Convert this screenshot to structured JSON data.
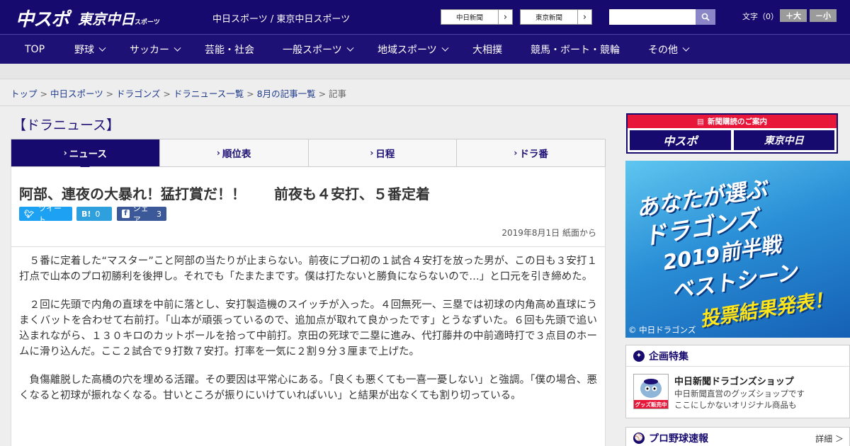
{
  "header": {
    "logo_chuspo": "中スポ",
    "logo_tokyo": "東京中日",
    "logo_tokyo_sub": "スポーツ",
    "site_names": "中日スポーツ / 東京中日スポーツ",
    "link_chunichi": "中日新聞",
    "link_tokyo": "東京新聞",
    "font_label": "文字（0）",
    "font_larger": "＋大",
    "font_smaller": "－小"
  },
  "nav": [
    {
      "label": "TOP"
    },
    {
      "label": "野球"
    },
    {
      "label": "サッカー"
    },
    {
      "label": "芸能・社会"
    },
    {
      "label": "一般スポーツ"
    },
    {
      "label": "地域スポーツ"
    },
    {
      "label": "大相撲"
    },
    {
      "label": "競馬・ボート・競輪"
    },
    {
      "label": "その他"
    }
  ],
  "breadcrumb": [
    "トップ",
    "中日スポーツ",
    "ドラゴンズ",
    "ドラニュース一覧",
    "8月の記事一覧",
    "記事"
  ],
  "section_title": "【ドラニュース】",
  "tabs": [
    "ニュース",
    "順位表",
    "日程",
    "ドラ番"
  ],
  "article": {
    "headline": "阿部、連夜の大暴れ！猛打賞だ！！　　前夜も４安打、５番定着",
    "share": {
      "tweet": "ツイート",
      "hatena_icon": "B!",
      "hatena_count": "0",
      "facebook": "シェア",
      "facebook_count": "3"
    },
    "dateline": "2019年8月1日 紙面から",
    "paragraphs": [
      "５番に定着した“マスター”こと阿部の当たりが止まらない。前夜にプロ初の１試合４安打を放った男が、この日も３安打１打点で山本のプロ初勝利を後押し。それでも「たまたまです。僕は打たないと勝負にならないので…」と口元を引き締めた。",
      "２回に先頭で内角の直球を中前に落とし、安打製造機のスイッチが入った。４回無死一、三塁では初球の内角高め直球にうまくバットを合わせて右前打。「山本が頑張っているので、追加点が取れて良かったです」とうなずいた。６回も先頭で追い込まれながら、１３０キロのカットボールを拾って中前打。京田の死球で二塁に進み、代打藤井の中前適時打で３点目のホームに滑り込んだ。ここ２試合で９打数７安打。打率を一気に２割９分３厘まで上げた。",
      "負傷離脱した高橋の穴を埋める活躍。その要因は平常心にある。「良くも悪くても一喜一憂しない」と強調。「僕の場合、悪くなると初球が振れなくなる。甘いところが振りにいけていればいい」と結果が出なくても割り切っている。"
    ]
  },
  "sidebar": {
    "subscribe_title": "新聞購読のご案内",
    "subscribe_logo1": "中スポ",
    "subscribe_logo2": "東京中日",
    "ad_lines": [
      "あなたが選ぶ",
      "ドラゴンズ",
      "2019前半戦",
      "ベストシーン"
    ],
    "ad_result": "投票結果発表！",
    "ad_copyright": "© 中日ドラゴンズ",
    "feature_title": "企画特集",
    "shop_title": "中日新聞ドラゴンズショップ",
    "shop_desc1": "中日新聞直営のグッズショップです",
    "shop_desc2": "ここにしかないオリジナル商品も",
    "shop_badge": "グッズ販売中",
    "baseball_title": "プロ野球速報",
    "baseball_more": "詳細 ＞"
  },
  "colors": {
    "header_bg": "#170a6e",
    "nav_bg": "#1e1175",
    "twitter": "#1da1f2",
    "hatena": "#2ea0dd",
    "facebook": "#3b5998",
    "subscribe_red": "#e8173a"
  }
}
